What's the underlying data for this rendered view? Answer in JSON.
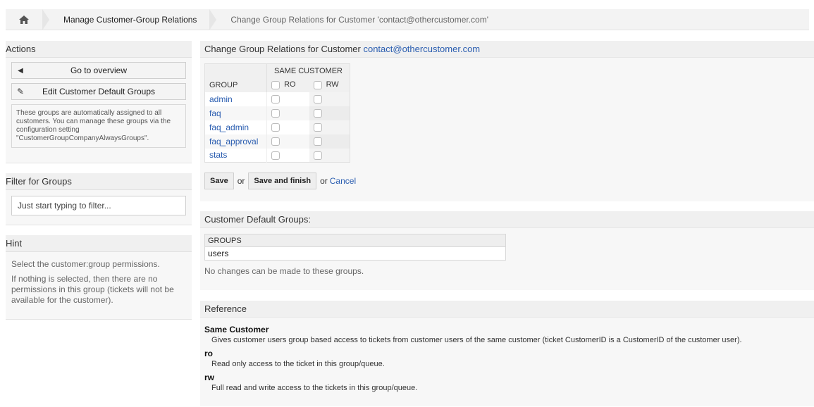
{
  "breadcrumb": {
    "home_icon": "home-icon",
    "items": [
      "Manage Customer-Group Relations",
      "Change Group Relations for Customer 'contact@othercustomer.com'"
    ]
  },
  "sidebar": {
    "actions": {
      "title": "Actions",
      "overview_label": "Go to overview",
      "edit_defaults_label": "Edit Customer Default Groups",
      "info": "These groups are automatically assigned to all customers. You can manage these groups via the configuration setting \"CustomerGroupCompanyAlwaysGroups\"."
    },
    "filter": {
      "title": "Filter for Groups",
      "placeholder": "Just start typing to filter..."
    },
    "hint": {
      "title": "Hint",
      "line1": "Select the customer:group permissions.",
      "line2": "If nothing is selected, then there are no permissions in this group (tickets will not be available for the customer)."
    }
  },
  "main": {
    "title_prefix": "Change Group Relations for Customer",
    "customer_email": "contact@othercustomer.com",
    "table": {
      "group_header": "SAME CUSTOMER",
      "col_group": "GROUP",
      "col_ro": "RO",
      "col_rw": "RW",
      "groups": [
        "admin",
        "faq",
        "faq_admin",
        "faq_approval",
        "stats"
      ]
    },
    "save_label": "Save",
    "or_text": "or",
    "save_finish_label": "Save and finish",
    "or_text2": "or",
    "cancel_label": "Cancel"
  },
  "defaults": {
    "title": "Customer Default Groups:",
    "col_groups": "GROUPS",
    "row": "users",
    "note": "No changes can be made to these groups."
  },
  "reference": {
    "title": "Reference",
    "items": [
      {
        "term": "Same Customer",
        "desc": "Gives customer users group based access to tickets from customer users of the same customer (ticket CustomerID is a CustomerID of the customer user)."
      },
      {
        "term": "ro",
        "desc": "Read only access to the ticket in this group/queue."
      },
      {
        "term": "rw",
        "desc": "Full read and write access to the tickets in this group/queue."
      }
    ]
  }
}
